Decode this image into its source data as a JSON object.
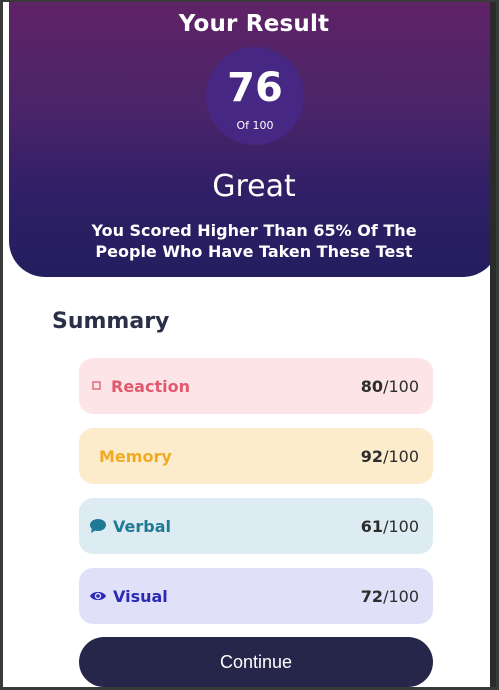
{
  "result": {
    "title": "Your Result",
    "score": "76",
    "score_total": "Of 100",
    "grade": "Great",
    "caption": "You Scored Higher Than 65% Of The People Who Have Taken These Test"
  },
  "summary": {
    "title": "Summary",
    "items": [
      {
        "label": "Reaction",
        "score": "80",
        "max": "/100",
        "icon": "reaction-icon",
        "text_color": "#e0596f",
        "bg_color": "#fde4e6"
      },
      {
        "label": "Memory",
        "score": "92",
        "max": "/100",
        "icon": "memory-icon",
        "text_color": "#f0aa23",
        "bg_color": "#fdeccc"
      },
      {
        "label": "Verbal",
        "score": "61",
        "max": "/100",
        "icon": "speech-bubble-icon",
        "text_color": "#1f7a96",
        "bg_color": "#dcecf2"
      },
      {
        "label": "Visual",
        "score": "72",
        "max": "/100",
        "icon": "eye-icon",
        "text_color": "#2a2ab6",
        "bg_color": "#e1e0f9"
      }
    ]
  },
  "actions": {
    "continue_label": "Continue"
  }
}
